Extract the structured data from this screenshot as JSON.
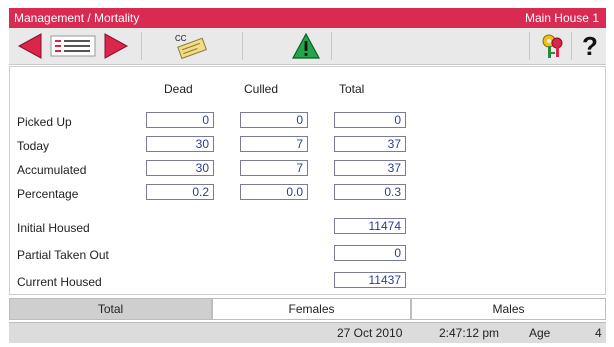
{
  "title": {
    "left": "Management / Mortality",
    "right": "Main House 1"
  },
  "toolbar": {
    "prev": "arrow-left-icon",
    "list": "list-icon",
    "next": "arrow-right-icon",
    "cc_label": "CC",
    "alarm": "warning-icon",
    "keys": "keys-icon",
    "help": "?"
  },
  "columns": [
    "Dead",
    "Culled",
    "Total"
  ],
  "rows": [
    {
      "label": "Picked Up",
      "dead": "0",
      "culled": "0",
      "total": "0"
    },
    {
      "label": "Today",
      "dead": "30",
      "culled": "7",
      "total": "37"
    },
    {
      "label": "Accumulated",
      "dead": "30",
      "culled": "7",
      "total": "37"
    },
    {
      "label": "Percentage",
      "dead": "0.2",
      "culled": "0.0",
      "total": "0.3"
    }
  ],
  "housing": [
    {
      "label": "Initial Housed",
      "value": "11474"
    },
    {
      "label": "Partial Taken Out",
      "value": "0"
    },
    {
      "label": "Current Housed",
      "value": "11437"
    }
  ],
  "tabs": [
    "Total",
    "Females",
    "Males"
  ],
  "active_tab": "Total",
  "status": {
    "date": "27 Oct 2010",
    "time": "2:47:12 pm",
    "age_label": "Age",
    "age": "4"
  },
  "colors": {
    "title_bar": "#d92a52",
    "field_text": "#2a3e8e",
    "warning": "#23a64a"
  }
}
